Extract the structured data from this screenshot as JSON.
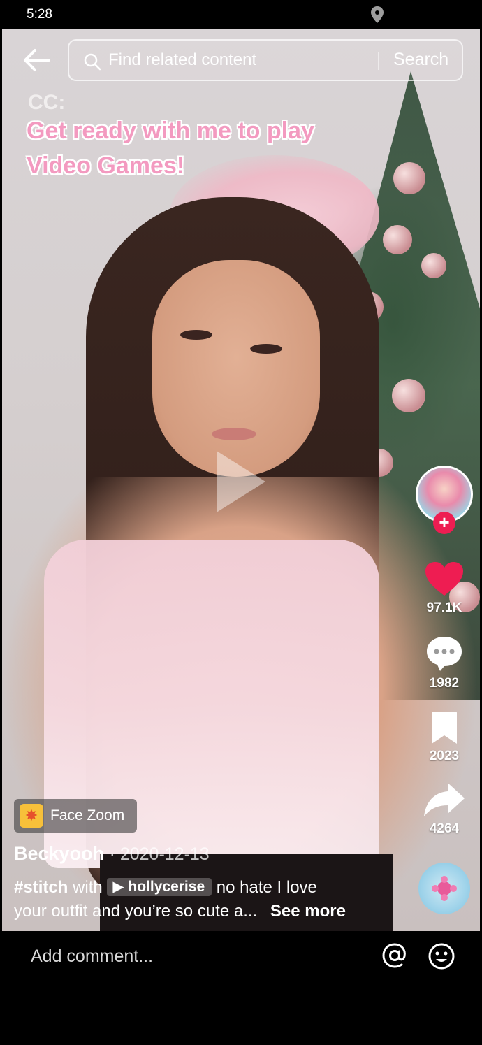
{
  "status": {
    "time": "5:28"
  },
  "search": {
    "placeholder": "Find related content",
    "button_label": "Search"
  },
  "overlay": {
    "cc_label": "CC:",
    "caption_line1": "Get ready with me to play",
    "caption_line2": "Video Games!"
  },
  "actions": {
    "likes": "97.1K",
    "comments": "1982",
    "saves": "2023",
    "shares": "4264"
  },
  "effect": {
    "label": "Face Zoom"
  },
  "post": {
    "author": "Beckyooh",
    "date": "· 2020-12-13",
    "hashtag": "#stitch",
    "with_word": "with",
    "stitched_user": "hollycerise",
    "desc_line1": "no hate I love",
    "desc_line2": "your outfit and you’re so cute a...",
    "see_more": "See more"
  },
  "comment": {
    "placeholder": "Add comment..."
  },
  "colors": {
    "like": "#ee1d52",
    "caption_pink": "#f39ac0"
  }
}
